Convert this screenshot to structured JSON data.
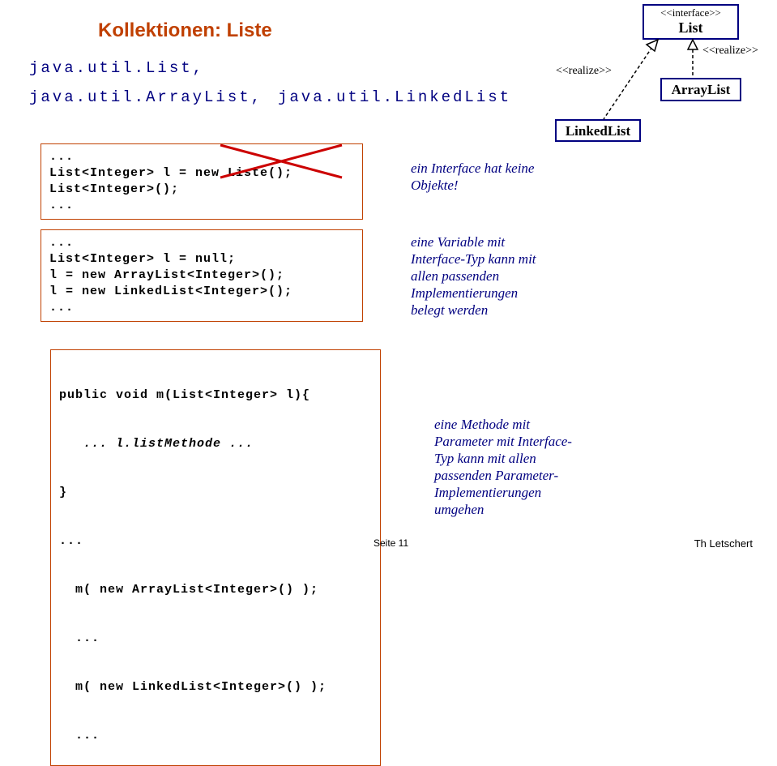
{
  "heading": "Kollektionen: Liste",
  "codeline1": "java.util.List,",
  "codeline2a": "java.util.ArrayList,",
  "codeline2b": "java.util.LinkedList",
  "uml": {
    "interface_tag": "<<interface>>",
    "list": "List",
    "arraylist": "ArrayList",
    "linkedlist": "LinkedList",
    "realize_left": "<<realize>>",
    "realize_right": "<<realize>>"
  },
  "box1": {
    "l1": "...",
    "l2": "List<Integer> l = new Liste();",
    "l3": "List<Integer>();",
    "l4": "..."
  },
  "box2": {
    "l1": "...",
    "l2": "List<Integer> l = null;",
    "l3": "l = new ArrayList<Integer>();",
    "l4": "l = new LinkedList<Integer>();",
    "l5": "..."
  },
  "box3": {
    "l1": "public void m(List<Integer> l){",
    "l2": "   ... l.listMethode ...",
    "l3": "}",
    "l4": "...",
    "l5": "  m( new ArrayList<Integer>() );",
    "l6": "  ...",
    "l7": "  m( new LinkedList<Integer>() );",
    "l8": "  ..."
  },
  "note1": {
    "l1": "ein Interface hat keine",
    "l2": "Objekte!"
  },
  "note2": {
    "l1": "eine Variable mit",
    "l2": "Interface-Typ kann mit",
    "l3": "allen passenden",
    "l4": "Implementierungen",
    "l5": "belegt werden"
  },
  "note3": {
    "l1": "eine Methode mit",
    "l2": "Parameter mit Interface-",
    "l3": "Typ kann mit allen",
    "l4": "passenden Parameter-",
    "l5": "Implementierungen",
    "l6": "umgehen"
  },
  "footer": {
    "page": "Seite 11",
    "author": "Th Letschert"
  }
}
